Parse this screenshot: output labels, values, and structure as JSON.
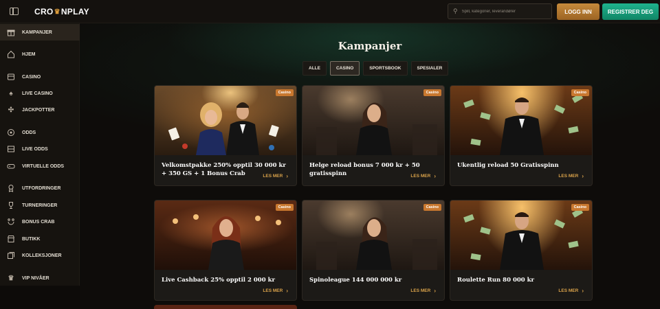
{
  "header": {
    "logo_left": "CRO",
    "logo_right": "NPLAY",
    "search_placeholder": "Spill, kategorier, leverandører",
    "login_label": "LOGG INN",
    "register_label": "REGISTRER DEG",
    "colors": {
      "login": "#b47730",
      "register": "#17a27d",
      "accent": "#d99a3a"
    }
  },
  "sidebar": {
    "items": [
      {
        "label": "KAMPANJER",
        "icon": "gift-icon",
        "active": true
      },
      {
        "label": "HJEM",
        "icon": "home-icon"
      },
      {
        "label": "CASINO",
        "icon": "slot-machine-icon"
      },
      {
        "label": "LIVE CASINO",
        "icon": "spade-icon"
      },
      {
        "label": "JACKPOTTER",
        "icon": "jackpot-icon"
      },
      {
        "label": "ODDS",
        "icon": "soccer-ball-icon"
      },
      {
        "label": "LIVE ODDS",
        "icon": "live-odds-icon"
      },
      {
        "label": "VIRTUELLE ODDS",
        "icon": "gamepad-icon"
      },
      {
        "label": "UTFORDRINGER",
        "icon": "medal-icon"
      },
      {
        "label": "TURNERINGER",
        "icon": "trophy-icon"
      },
      {
        "label": "BONUS CRAB",
        "icon": "crab-icon"
      },
      {
        "label": "BUTIKK",
        "icon": "shop-icon"
      },
      {
        "label": "KOLLEKSJONER",
        "icon": "collection-icon"
      },
      {
        "label": "VIP NIVÅER",
        "icon": "crown-icon"
      }
    ]
  },
  "main": {
    "title": "Kampanjer",
    "tabs": [
      {
        "label": "ALLE"
      },
      {
        "label": "CASINO",
        "active": true
      },
      {
        "label": "SPORTSBOOK"
      },
      {
        "label": "SPESIALER"
      }
    ],
    "cards": [
      {
        "badge": "Casino",
        "title": "Velkomstpakke 250% opptil 30 000 kr + 350 GS + 1 Bonus Crab",
        "more": "LES MER"
      },
      {
        "badge": "Casino",
        "title": "Helge reload bonus 7 000 kr + 50 gratisspinn",
        "more": "LES MER"
      },
      {
        "badge": "Casino",
        "title": "Ukentlig reload 50 Gratisspinn",
        "more": "LES MER"
      },
      {
        "badge": "Casino",
        "title": "Live Cashback 25% opptil 2 000 kr",
        "more": "LES MER"
      },
      {
        "badge": "Casino",
        "title": "Spinoleague 144 000 000 kr",
        "more": "LES MER"
      },
      {
        "badge": "Casino",
        "title": "Roulette Run 80 000 kr",
        "more": "LES MER"
      }
    ]
  }
}
